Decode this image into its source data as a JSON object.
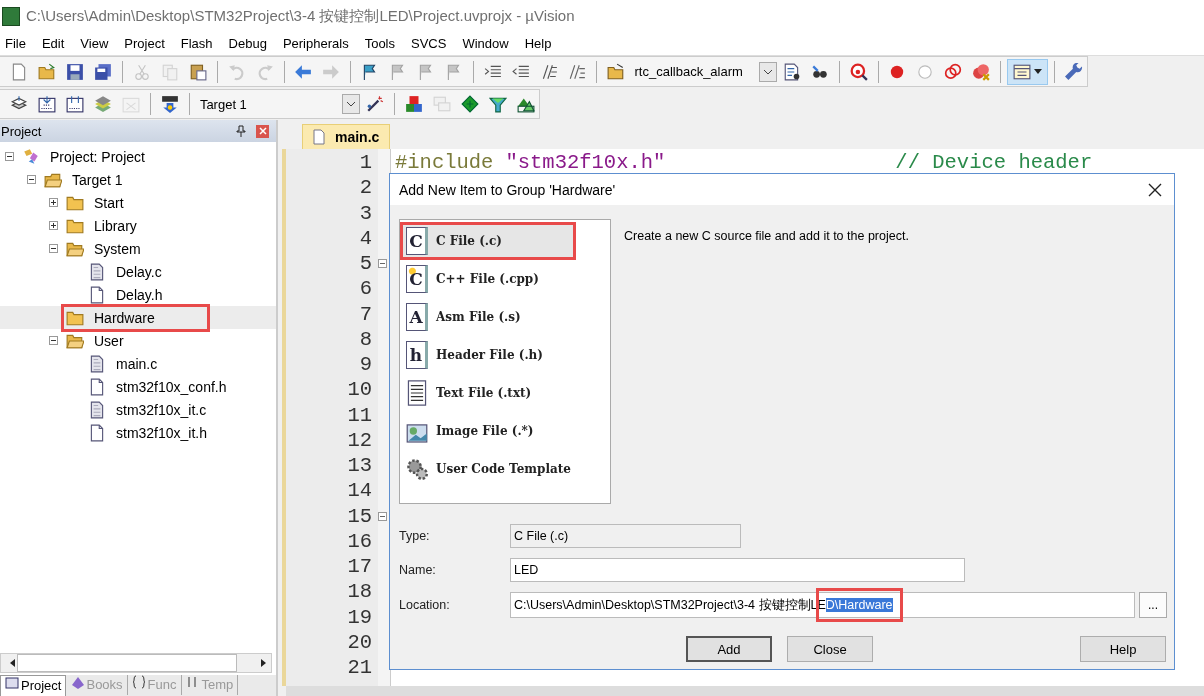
{
  "window": {
    "title": "C:\\Users\\Admin\\Desktop\\STM32Project\\3-4 按键控制LED\\Project.uvprojx - µVision"
  },
  "menu": [
    "File",
    "Edit",
    "View",
    "Project",
    "Flash",
    "Debug",
    "Peripherals",
    "Tools",
    "SVCS",
    "Window",
    "Help"
  ],
  "toolbar_1": [
    {
      "kind": "new",
      "disabled": false,
      "pressed": false
    },
    {
      "kind": "open",
      "disabled": false,
      "pressed": false
    },
    {
      "kind": "save",
      "disabled": false,
      "pressed": false
    },
    {
      "kind": "saveall",
      "disabled": false,
      "pressed": false
    },
    {
      "kind": "sep"
    },
    {
      "kind": "cut",
      "disabled": true,
      "pressed": false
    },
    {
      "kind": "copy",
      "disabled": true,
      "pressed": false
    },
    {
      "kind": "paste",
      "disabled": false,
      "pressed": false
    },
    {
      "kind": "sep"
    },
    {
      "kind": "undo",
      "disabled": true,
      "pressed": false
    },
    {
      "kind": "redo",
      "disabled": true,
      "pressed": false
    },
    {
      "kind": "sep"
    },
    {
      "kind": "back",
      "disabled": false,
      "pressed": false
    },
    {
      "kind": "forward",
      "disabled": true,
      "pressed": false
    },
    {
      "kind": "sep"
    },
    {
      "kind": "flag",
      "disabled": false,
      "pressed": false
    },
    {
      "kind": "flag",
      "disabled": true,
      "pressed": false
    },
    {
      "kind": "flag",
      "disabled": true,
      "pressed": false
    },
    {
      "kind": "flag",
      "disabled": true,
      "pressed": false
    },
    {
      "kind": "sep"
    },
    {
      "kind": "indent",
      "disabled": false,
      "pressed": false
    },
    {
      "kind": "outdent",
      "disabled": false,
      "pressed": false
    },
    {
      "kind": "comment",
      "disabled": false,
      "pressed": false
    },
    {
      "kind": "uncomment",
      "disabled": false,
      "pressed": false
    },
    {
      "kind": "sep"
    },
    {
      "kind": "openfolder",
      "disabled": false,
      "pressed": false
    },
    {
      "kind": "combo",
      "value": "rtc_callback_alarm"
    },
    {
      "kind": "findfiles",
      "disabled": false,
      "pressed": false
    },
    {
      "kind": "binoculars",
      "disabled": false,
      "pressed": false
    },
    {
      "kind": "sep"
    },
    {
      "kind": "debug",
      "disabled": false,
      "pressed": false
    },
    {
      "kind": "sep"
    },
    {
      "kind": "breakpoint",
      "disabled": false,
      "pressed": false
    },
    {
      "kind": "circle",
      "disabled": false,
      "pressed": false
    },
    {
      "kind": "circles",
      "disabled": false,
      "pressed": false
    },
    {
      "kind": "killbreak",
      "disabled": false,
      "pressed": false
    },
    {
      "kind": "sep"
    },
    {
      "kind": "windows",
      "disabled": false,
      "pressed": true
    },
    {
      "kind": "sep"
    },
    {
      "kind": "wrench",
      "disabled": false,
      "pressed": false
    }
  ],
  "toolbar_2": [
    {
      "kind": "translate",
      "disabled": false,
      "pressed": false
    },
    {
      "kind": "build",
      "disabled": false,
      "pressed": false
    },
    {
      "kind": "rebuild",
      "disabled": false,
      "pressed": false
    },
    {
      "kind": "batch",
      "disabled": false,
      "pressed": false
    },
    {
      "kind": "stopbuild",
      "disabled": true,
      "pressed": false
    },
    {
      "kind": "sep"
    },
    {
      "kind": "load",
      "disabled": false,
      "pressed": false
    },
    {
      "kind": "sep"
    },
    {
      "kind": "combo",
      "value": "Target 1"
    },
    {
      "kind": "wand",
      "disabled": false,
      "pressed": false
    },
    {
      "kind": "sep"
    },
    {
      "kind": "blocks",
      "disabled": false,
      "pressed": false
    },
    {
      "kind": "manage",
      "disabled": true,
      "pressed": false
    },
    {
      "kind": "diamond",
      "disabled": false,
      "pressed": false
    },
    {
      "kind": "funnel",
      "disabled": false,
      "pressed": false
    },
    {
      "kind": "pack",
      "disabled": false,
      "pressed": false
    }
  ],
  "project_panel": {
    "title": "Project",
    "tree": [
      {
        "label": "Project: Project",
        "kind": "project",
        "expanded": true,
        "selected": false,
        "children": [
          {
            "label": "Target 1",
            "kind": "target",
            "expanded": true,
            "selected": false,
            "children": [
              {
                "label": "Start",
                "kind": "group",
                "expanded": false,
                "selected": false
              },
              {
                "label": "Library",
                "kind": "group",
                "expanded": false,
                "selected": false
              },
              {
                "label": "System",
                "kind": "group",
                "expanded": true,
                "selected": false,
                "children": [
                  {
                    "label": "Delay.c",
                    "kind": "source",
                    "selected": false
                  },
                  {
                    "label": "Delay.h",
                    "kind": "file",
                    "selected": false
                  }
                ]
              },
              {
                "label": "Hardware",
                "kind": "group",
                "selected": true,
                "annotated": true
              },
              {
                "label": "User",
                "kind": "group",
                "expanded": true,
                "selected": false,
                "children": [
                  {
                    "label": "main.c",
                    "kind": "source",
                    "selected": false
                  },
                  {
                    "label": "stm32f10x_conf.h",
                    "kind": "file",
                    "selected": false
                  },
                  {
                    "label": "stm32f10x_it.c",
                    "kind": "source",
                    "selected": false
                  },
                  {
                    "label": "stm32f10x_it.h",
                    "kind": "file",
                    "selected": false
                  }
                ]
              }
            ]
          }
        ]
      }
    ],
    "tabs": [
      {
        "label": "Project",
        "selected": true
      },
      {
        "label": "Books",
        "selected": false
      },
      {
        "label": "Func",
        "selected": false
      },
      {
        "label": "Temp",
        "selected": false
      }
    ]
  },
  "editor": {
    "tab": {
      "label": "main.c",
      "selected": true
    },
    "lines": [
      {
        "number": "1",
        "fold": false,
        "code": [
          {
            "text": "#include",
            "kind": "preproc"
          },
          {
            "text": "\"stm32f10x.h\"",
            "kind": "string"
          },
          {
            "text": "// Device header",
            "kind": "comment"
          }
        ]
      },
      {
        "number": "2",
        "fold": false
      },
      {
        "number": "3",
        "fold": false
      },
      {
        "number": "4",
        "fold": false
      },
      {
        "number": "5",
        "fold": true
      },
      {
        "number": "6",
        "fold": false
      },
      {
        "number": "7",
        "fold": false
      },
      {
        "number": "8",
        "fold": false
      },
      {
        "number": "9",
        "fold": false
      },
      {
        "number": "10",
        "fold": false
      },
      {
        "number": "11",
        "fold": false
      },
      {
        "number": "12",
        "fold": false
      },
      {
        "number": "13",
        "fold": false
      },
      {
        "number": "14",
        "fold": false
      },
      {
        "number": "15",
        "fold": true
      },
      {
        "number": "16",
        "fold": false
      },
      {
        "number": "17",
        "fold": false
      },
      {
        "number": "18",
        "fold": false
      },
      {
        "number": "19",
        "fold": false
      },
      {
        "number": "20",
        "fold": false
      },
      {
        "number": "21",
        "fold": false
      }
    ]
  },
  "dialog": {
    "title": "Add New Item to Group 'Hardware'",
    "items": [
      {
        "label": "C File (.c)",
        "kind": "c",
        "badge": "C",
        "selected": true,
        "annotated": true
      },
      {
        "label": "C++ File (.cpp)",
        "kind": "cpp",
        "badge": "C",
        "selected": false,
        "annotated": false
      },
      {
        "label": "Asm File (.s)",
        "kind": "asm",
        "badge": "A",
        "selected": false,
        "annotated": false
      },
      {
        "label": "Header File (.h)",
        "kind": "header",
        "badge": "h",
        "selected": false,
        "annotated": false
      },
      {
        "label": "Text File (.txt)",
        "kind": "text",
        "selected": false,
        "annotated": false
      },
      {
        "label": "Image File (.*)",
        "kind": "image",
        "selected": false,
        "annotated": false
      },
      {
        "label": "User Code Template",
        "kind": "template",
        "selected": false,
        "annotated": false
      }
    ],
    "description": "Create a new C source file and add it to the project.",
    "type": {
      "label": "Type:",
      "value": "C File (.c)"
    },
    "name": {
      "label": "Name:",
      "value": "LED"
    },
    "location": {
      "label": "Location:",
      "value": "C:\\Users\\Admin\\Desktop\\STM32Project\\3-4 按键控制LE",
      "selection": "D\\Hardware",
      "annotated": true,
      "browse": "..."
    },
    "buttons": [
      "Add",
      "Close",
      "Help"
    ]
  }
}
